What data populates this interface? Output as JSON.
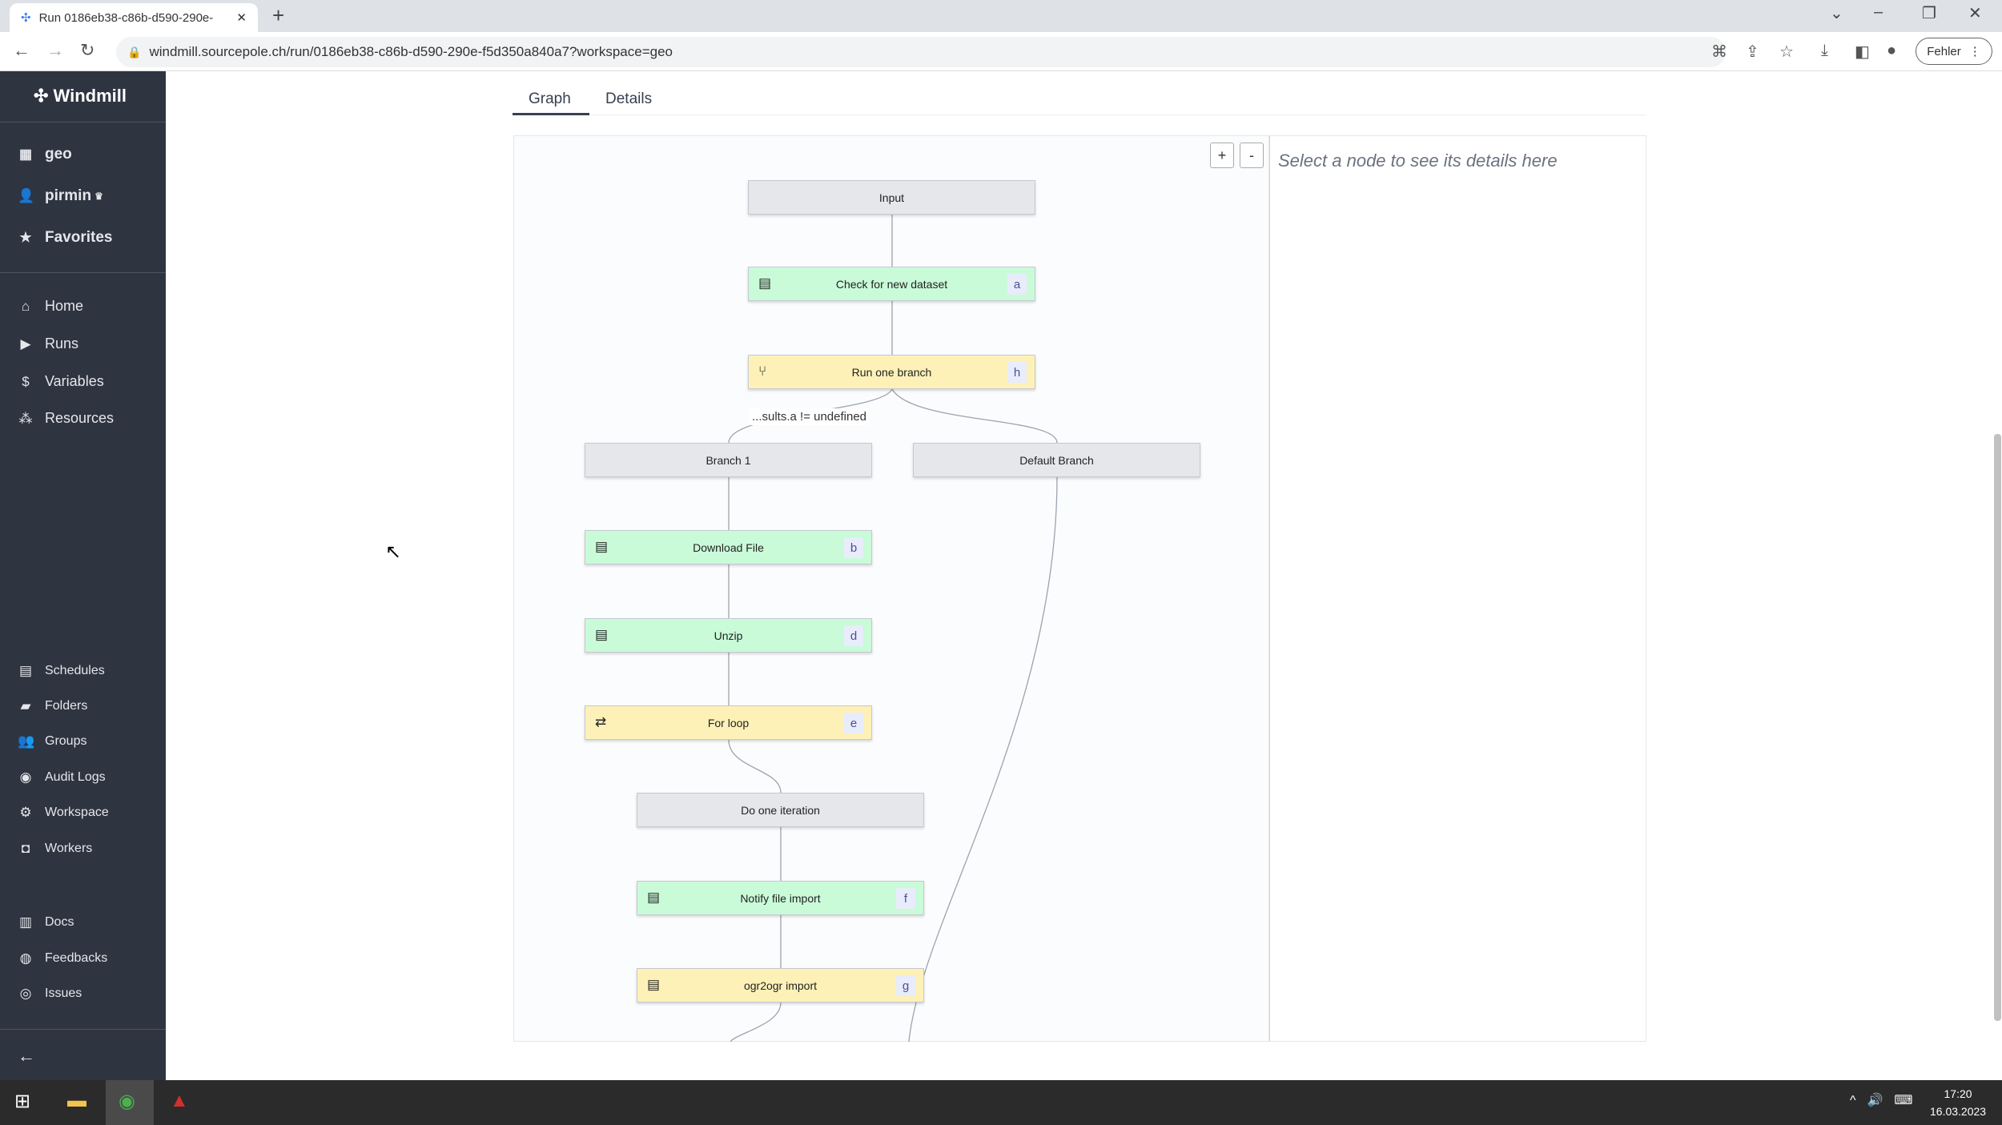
{
  "browser": {
    "tab_title": "Run 0186eb38-c86b-d590-290e-",
    "url": "windmill.sourcepole.ch/run/0186eb38-c86b-d590-290e-f5d350a840a7?workspace=geo",
    "profile_button": "Fehler"
  },
  "sidebar": {
    "brand": "Windmill",
    "workspace": "geo",
    "user": "pirmin",
    "favorites": "Favorites",
    "main": [
      {
        "label": "Home",
        "icon": "home-icon"
      },
      {
        "label": "Runs",
        "icon": "play-icon"
      },
      {
        "label": "Variables",
        "icon": "dollar-icon"
      },
      {
        "label": "Resources",
        "icon": "cubes-icon"
      }
    ],
    "secondary": [
      {
        "label": "Schedules"
      },
      {
        "label": "Folders"
      },
      {
        "label": "Groups"
      },
      {
        "label": "Audit Logs"
      },
      {
        "label": "Workspace"
      },
      {
        "label": "Workers"
      }
    ],
    "links": [
      {
        "label": "Docs"
      },
      {
        "label": "Feedbacks"
      },
      {
        "label": "Issues"
      }
    ]
  },
  "tabs": [
    {
      "label": "Graph",
      "active": true
    },
    {
      "label": "Details",
      "active": false
    }
  ],
  "graph": {
    "zoom_in": "+",
    "zoom_out": "-",
    "edge_label": "...sults.a != undefined",
    "nodes": [
      {
        "label": "Input",
        "id": ""
      },
      {
        "label": "Check for new dataset",
        "id": "a",
        "type": "script",
        "color": "#c9fbd9"
      },
      {
        "label": "Run one branch",
        "id": "h",
        "type": "branch",
        "color": "#fdf1b8"
      },
      {
        "label": "Branch 1",
        "id": ""
      },
      {
        "label": "Default Branch",
        "id": ""
      },
      {
        "label": "Download File",
        "id": "b",
        "type": "script",
        "color": "#c9fbd9"
      },
      {
        "label": "Unzip",
        "id": "d",
        "type": "script",
        "color": "#c9fbd9"
      },
      {
        "label": "For loop",
        "id": "e",
        "type": "loop",
        "color": "#fdf1b8"
      },
      {
        "label": "Do one iteration",
        "id": ""
      },
      {
        "label": "Notify file import",
        "id": "f",
        "type": "script",
        "color": "#c9fbd9"
      },
      {
        "label": "ogr2ogr import",
        "id": "g",
        "type": "script",
        "color": "#fdf1b8"
      }
    ]
  },
  "details": {
    "placeholder": "Select a node to see its details here"
  },
  "taskbar": {
    "time": "17:20",
    "date": "16.03.2023"
  }
}
